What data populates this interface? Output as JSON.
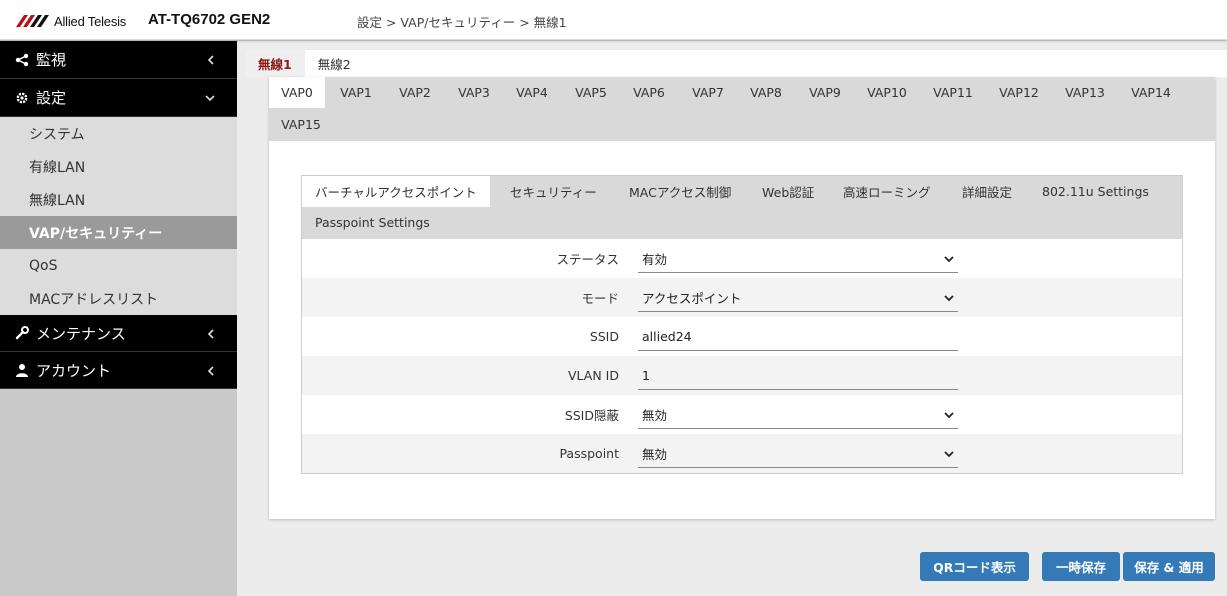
{
  "header": {
    "brand": "Allied Telesis",
    "model": "AT-TQ6702 GEN2",
    "breadcrumb": "設定 > VAP/セキュリティー > 無線1"
  },
  "sidebar": {
    "sections": [
      {
        "label": "監視",
        "icon": "share-icon",
        "expanded": false
      },
      {
        "label": "設定",
        "icon": "gear-icon",
        "expanded": true
      },
      {
        "label": "メンテナンス",
        "icon": "wrench-icon",
        "expanded": false
      },
      {
        "label": "アカウント",
        "icon": "user-icon",
        "expanded": false
      }
    ],
    "settings_items": [
      "システム",
      "有線LAN",
      "無線LAN",
      "VAP/セキュリティー",
      "QoS",
      "MACアドレスリスト"
    ],
    "active_item": "VAP/セキュリティー"
  },
  "radio_tabs": [
    "無線1",
    "無線2"
  ],
  "vap_tabs": [
    "VAP0",
    "VAP1",
    "VAP2",
    "VAP3",
    "VAP4",
    "VAP5",
    "VAP6",
    "VAP7",
    "VAP8",
    "VAP9",
    "VAP10",
    "VAP11",
    "VAP12",
    "VAP13",
    "VAP14",
    "VAP15"
  ],
  "sub_tabs": [
    "バーチャルアクセスポイント",
    "セキュリティー",
    "MACアクセス制御",
    "Web認証",
    "高速ローミング",
    "詳細設定",
    "802.11u Settings",
    "Passpoint Settings"
  ],
  "form": {
    "status": {
      "label": "ステータス",
      "value": "有効"
    },
    "mode": {
      "label": "モード",
      "value": "アクセスポイント"
    },
    "ssid": {
      "label": "SSID",
      "value": "allied24"
    },
    "vlan_id": {
      "label": "VLAN ID",
      "value": "1"
    },
    "ssid_hide": {
      "label": "SSID隠蔽",
      "value": "無効"
    },
    "passpoint": {
      "label": "Passpoint",
      "value": "無効"
    }
  },
  "buttons": {
    "qr": "QRコード表示",
    "temp_save": "一時保存",
    "save_apply": "保存 & 適用"
  },
  "colors": {
    "accent_red": "#8b1c1c",
    "button_blue": "#337ab7",
    "sidebar_black": "#000000",
    "active_item_gray": "#9a9a9a"
  }
}
